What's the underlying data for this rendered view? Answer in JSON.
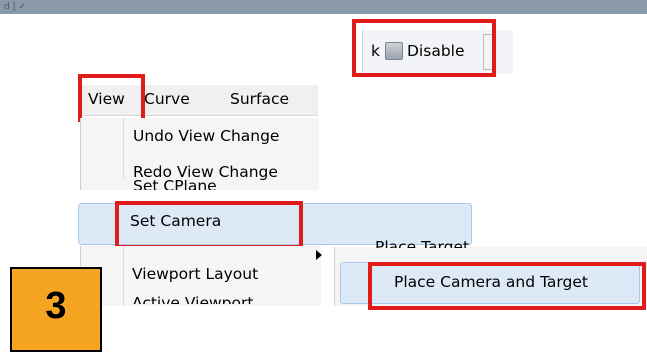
{
  "top_strip": {
    "fragment": "d  |  ✓"
  },
  "toolbar": {
    "cut_letter": "k",
    "disable_label": "Disable"
  },
  "menubar": {
    "items": [
      "View",
      "Curve",
      "Surface"
    ]
  },
  "view_menu": {
    "items": [
      "Undo View Change",
      "Redo View Change"
    ],
    "clipped_item": "Set CPlane",
    "set_camera": "Set Camera",
    "viewport_layout": "Viewport Layout",
    "active_viewport": "Active Viewport"
  },
  "set_camera_submenu": {
    "clipped_item": "Place Target",
    "place_camera_and_target": "Place Camera and Target"
  },
  "step": {
    "number": "3",
    "color": "#f6a523"
  },
  "highlight_color": "#e11a1a"
}
